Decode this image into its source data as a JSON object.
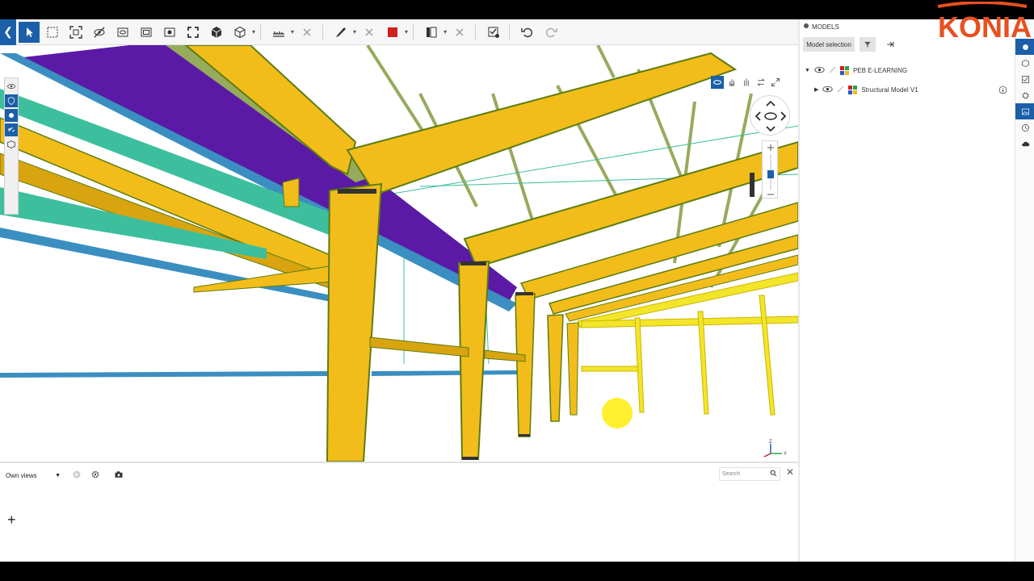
{
  "toolbar": {
    "icons": [
      "back-icon",
      "select-arrow-icon",
      "box-select-icon",
      "fit-selection-icon",
      "hide-icon",
      "clip-box-icon",
      "clip-plane-icon",
      "isolate-icon",
      "fullscreen-icon",
      "objects-icon",
      "view-cube-icon",
      "measure-icon",
      "close-icon",
      "markup-pen-icon",
      "close-icon",
      "color-swatch-icon",
      "section-icon",
      "close-icon",
      "settings-check-icon",
      "undo-icon",
      "redo-icon"
    ],
    "swatch_color": "#d21f1f",
    "accent": "#1b5fa8"
  },
  "viewport": {
    "colors": {
      "primary_steel": "#f2bd1a",
      "edge": "#5d7d12",
      "purlin_purple": "#5a1aa6",
      "purlin_blue": "#3b8fc0",
      "purlin_teal": "#3dbf9e",
      "bracing_olive": "#96ab5c",
      "light_yellow": "#f3e52a"
    }
  },
  "bottom_panel": {
    "own_views_label": "Own views",
    "search_placeholder": "Search",
    "add_view_symbol": "+"
  },
  "models_panel": {
    "title": "MODELS",
    "model_selection_label": "Model selection",
    "tree": [
      {
        "label": "PEB E-LEARNING",
        "expanded": true
      },
      {
        "label": "Structural Model V1",
        "expanded": false
      }
    ]
  },
  "logo": {
    "text": "KONIA",
    "color": "#e8501f"
  }
}
